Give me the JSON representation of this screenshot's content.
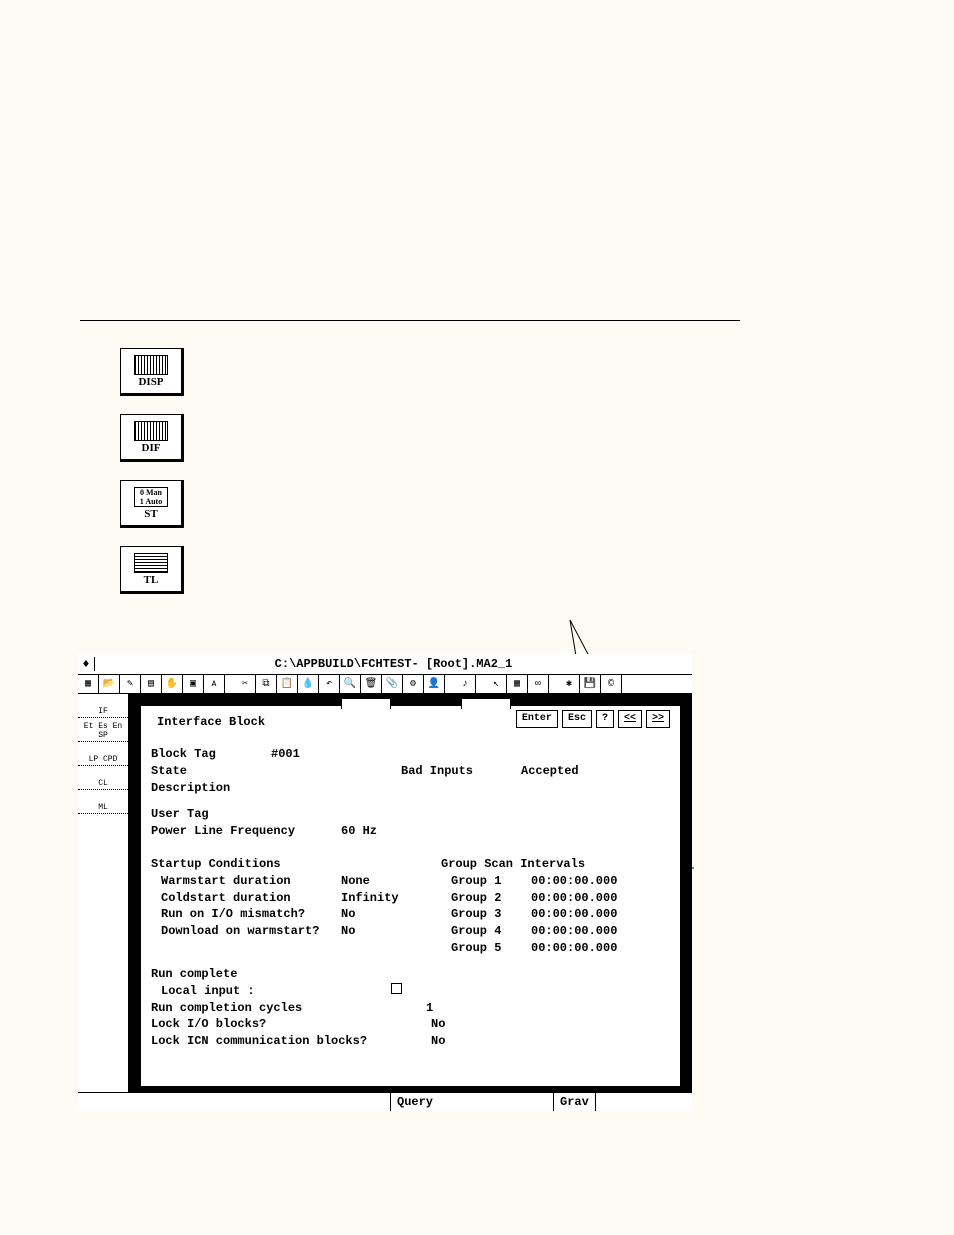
{
  "icons": {
    "disp": "DISP",
    "dif": "DIF",
    "st": "ST",
    "st_inner_top": "0  Man",
    "st_inner_bot": "1  Auto",
    "tl": "TL"
  },
  "window": {
    "title": "C:\\APPBUILD\\FCHTEST- [Root].MA2_1",
    "sidebar": [
      "IF",
      "Et Es En SP",
      "LP CPD",
      "CL",
      "ML"
    ]
  },
  "dialog": {
    "title": "Interface Block",
    "ctrl": {
      "enter": "Enter",
      "esc": "Esc",
      "help": "?",
      "prev": "<<",
      "next": ">>"
    },
    "block_tag_label": "Block Tag",
    "block_tag_value": "#001",
    "state_label": "State",
    "bad_inputs_label": "Bad Inputs",
    "bad_inputs_value": "Accepted",
    "desc_label": "Description",
    "user_tag_label": "User Tag",
    "plf_label": "Power Line Frequency",
    "plf_value": "60 Hz",
    "startup_heading": "Startup Conditions",
    "startup": [
      {
        "l": "Warmstart duration",
        "v": "None"
      },
      {
        "l": "Coldstart duration",
        "v": "Infinity"
      },
      {
        "l": "Run on I/O mismatch?",
        "v": "No"
      },
      {
        "l": "Download on warmstart?",
        "v": "No"
      }
    ],
    "scan_heading": "Group Scan Intervals",
    "scan": [
      {
        "l": "Group 1",
        "v": "00:00:00.000"
      },
      {
        "l": "Group 2",
        "v": "00:00:00.000"
      },
      {
        "l": "Group 3",
        "v": "00:00:00.000"
      },
      {
        "l": "Group 4",
        "v": "00:00:00.000"
      },
      {
        "l": "Group 5",
        "v": "00:00:00.000"
      }
    ],
    "run_complete_label": "Run complete",
    "local_input_label": "Local input :",
    "run_cycles_label": "Run completion cycles",
    "run_cycles_value": "1",
    "lock_io_label": "Lock I/O blocks?",
    "lock_io_value": "No",
    "lock_icn_label": "Lock ICN communication blocks?",
    "lock_icn_value": "No"
  },
  "status": {
    "query": "Query",
    "grav": "Grav"
  }
}
